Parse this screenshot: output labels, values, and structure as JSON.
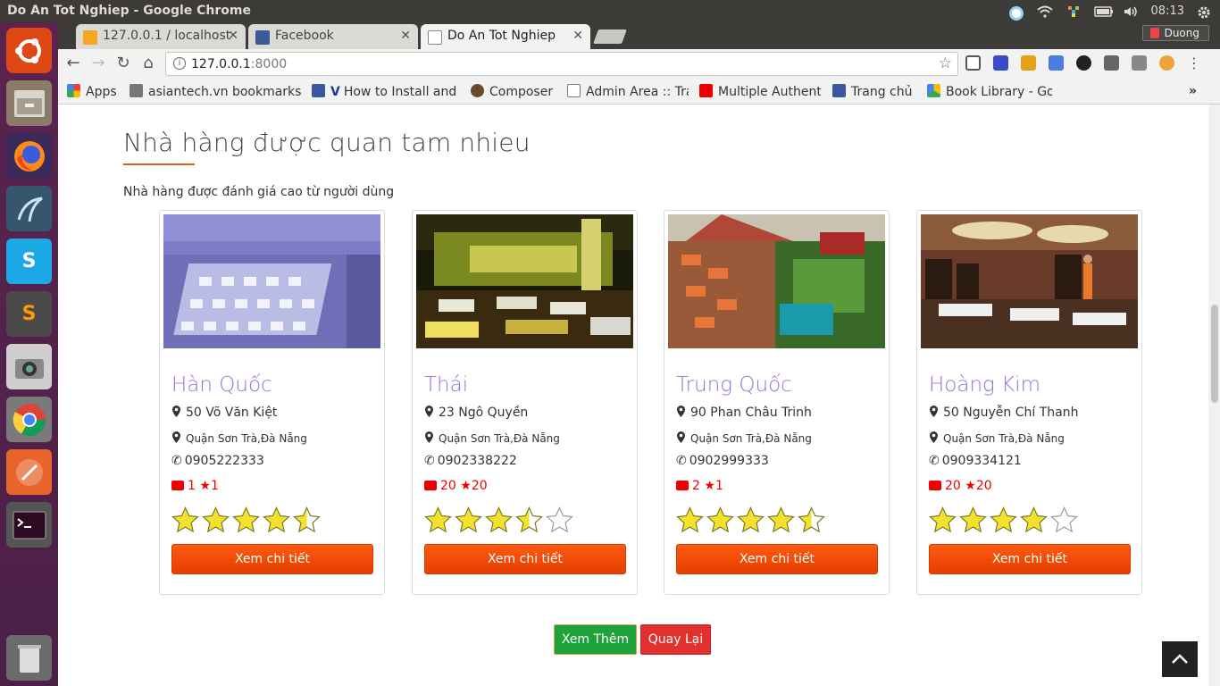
{
  "os": {
    "window_title": "Do An Tot Nghiep - Google Chrome",
    "clock": "08:13"
  },
  "browser": {
    "tabs": [
      {
        "label": "127.0.0.1 / localhost",
        "active": false
      },
      {
        "label": "Facebook",
        "active": false
      },
      {
        "label": "Do An Tot Nghiep",
        "active": true
      }
    ],
    "profile_name": "Duong",
    "url_host": "127.0.0.1",
    "url_port": ":8000",
    "bookmarks": [
      {
        "label": "Apps",
        "icon": "apps-grid-icon"
      },
      {
        "label": "asiantech.vn bookmarks",
        "icon": "folder-icon"
      },
      {
        "label": "How to Install and",
        "icon": "v-icon"
      },
      {
        "label": "Composer",
        "icon": "composer-icon"
      },
      {
        "label": "Admin Area :: Tra",
        "icon": "page-icon"
      },
      {
        "label": "Multiple Authent",
        "icon": "youtube-icon"
      },
      {
        "label": "Trang chủ",
        "icon": "facebook-icon"
      },
      {
        "label": "Book Library - Go",
        "icon": "drive-icon"
      }
    ]
  },
  "page": {
    "section_title": "Nhà hàng được quan tam nhieu",
    "subtitle": "Nhà hàng được đánh giá cao từ người dùng",
    "restaurants": [
      {
        "name": "Hàn Quốc",
        "address": "50 Võ Văn Kiệt",
        "district": "Quận Sơn Trà,Đà Nẵng",
        "phone": "0905222333",
        "comments": "1",
        "rating_count": "1",
        "stars": 4.5,
        "button": "Xem chi tiết"
      },
      {
        "name": "Thái",
        "address": "23 Ngô Quyền",
        "district": "Quận Sơn Trà,Đà Nẵng",
        "phone": "0902338222",
        "comments": "20",
        "rating_count": "20",
        "stars": 3.5,
        "button": "Xem chi tiết"
      },
      {
        "name": "Trung Quốc",
        "address": "90 Phan Châu Trinh",
        "district": "Quận Sơn Trà,Đà Nẵng",
        "phone": "0902999333",
        "comments": "2",
        "rating_count": "1",
        "stars": 4.5,
        "button": "Xem chi tiết"
      },
      {
        "name": "Hoàng Kim",
        "address": "50 Nguyễn Chí Thanh",
        "district": "Quận Sơn Trà,Đà Nẵng",
        "phone": "0909334121",
        "comments": "20",
        "rating_count": "20",
        "stars": 4,
        "button": "Xem chi tiết"
      }
    ],
    "more_button": "Xem Thêm",
    "back_button": "Quay Lại"
  },
  "colors": {
    "name": "#9b6fd6",
    "accent": "#e05a1b",
    "detail_button": "#ff4a05",
    "more_button": "#1ea23a",
    "back_button": "#e2302e"
  }
}
